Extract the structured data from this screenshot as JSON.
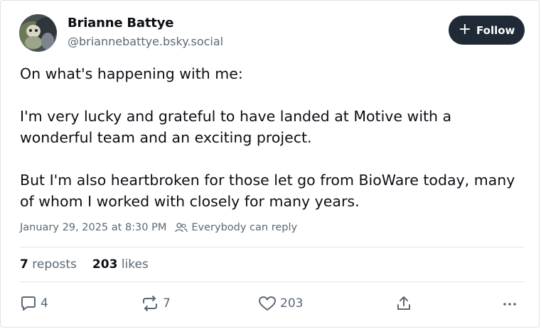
{
  "author": {
    "display_name": "Brianne Battye",
    "handle": "@briannebattye.bsky.social"
  },
  "follow_button": {
    "label": "Follow"
  },
  "post": {
    "paragraphs": [
      "On what's happening with me:",
      "I'm very lucky and grateful to have landed at Motive with a wonderful team and an exciting project.",
      "But I'm also heartbroken for those let go from BioWare today, many of whom I worked with closely for many years."
    ],
    "timestamp": "January 29, 2025 at 8:30 PM",
    "reply_setting": "Everybody can reply"
  },
  "stats": {
    "reposts_count": "7",
    "reposts_label": "reposts",
    "likes_count": "203",
    "likes_label": "likes"
  },
  "actions": {
    "reply_count": "4",
    "repost_count": "7",
    "like_count": "203"
  },
  "colors": {
    "text_primary": "#0b0f14",
    "text_secondary": "#5b6874",
    "button_bg": "#1f2a36",
    "divider": "#dfe3e8"
  },
  "icons": [
    "avatar-photo",
    "plus-icon",
    "people-icon",
    "reply-icon",
    "repost-icon",
    "heart-icon",
    "share-icon",
    "more-icon"
  ]
}
